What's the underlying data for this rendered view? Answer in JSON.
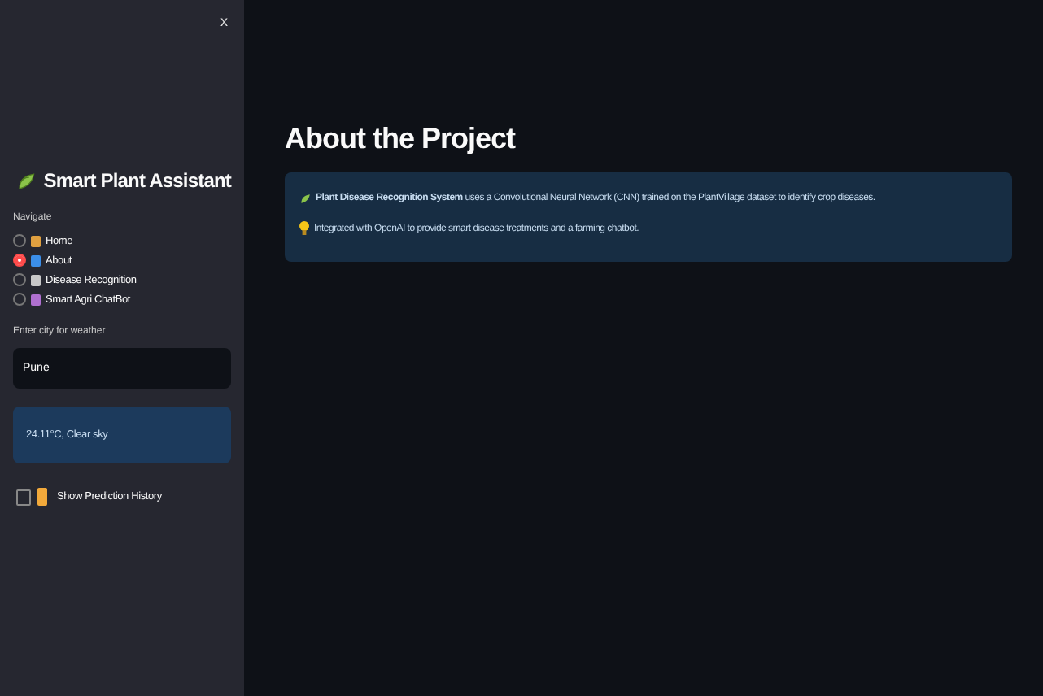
{
  "sidebar": {
    "close": "x",
    "title": "Smart Plant Assistant",
    "nav_label": "Navigate",
    "nav_items": [
      {
        "label": "Home",
        "selected": false
      },
      {
        "label": "About",
        "selected": true
      },
      {
        "label": "Disease Recognition",
        "selected": false
      },
      {
        "label": "Smart Agri ChatBot",
        "selected": false
      }
    ],
    "city_label": "Enter city for weather",
    "city_value": "Pune",
    "weather": "24.11°C, Clear sky",
    "history": {
      "label": "Show Prediction History",
      "checked": false
    }
  },
  "main": {
    "title": "About the Project",
    "info": [
      "**Plant Disease Recognition System** uses a Convolutional Neural Network (CNN) trained on the PlantVillage dataset to identify crop diseases.",
      "Integrated with OpenAI to provide smart disease treatments and a farming chatbot."
    ]
  }
}
